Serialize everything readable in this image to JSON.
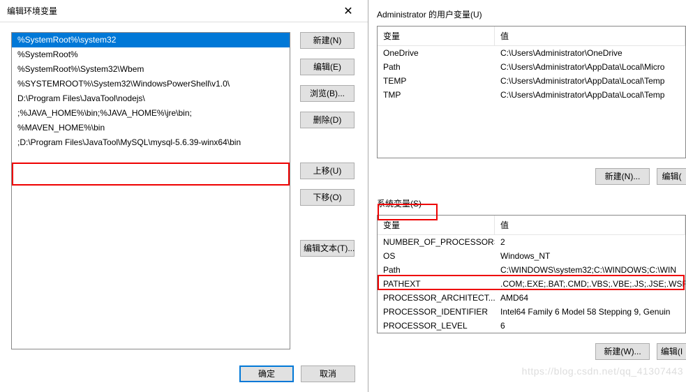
{
  "left_dialog": {
    "title": "编辑环境变量",
    "list": [
      "%SystemRoot%\\system32",
      "%SystemRoot%",
      "%SystemRoot%\\System32\\Wbem",
      "%SYSTEMROOT%\\System32\\WindowsPowerShell\\v1.0\\",
      "D:\\Program Files\\JavaTool\\nodejs\\",
      ";%JAVA_HOME%\\bin;%JAVA_HOME%\\jre\\bin;",
      "%MAVEN_HOME%\\bin",
      ";D:\\Program Files\\JavaTool\\MySQL\\mysql-5.6.39-winx64\\bin"
    ],
    "selected_index": 0,
    "buttons": {
      "new": "新建(N)",
      "edit": "编辑(E)",
      "browse": "浏览(B)...",
      "delete": "删除(D)",
      "move_up": "上移(U)",
      "move_down": "下移(O)",
      "edit_text": "编辑文本(T)..."
    },
    "ok": "确定",
    "cancel": "取消"
  },
  "right": {
    "user_vars_label": "Administrator 的用户变量(U)",
    "sys_vars_label": "系统变量(S)",
    "headers": {
      "name": "变量",
      "value": "值"
    },
    "user_vars": [
      {
        "name": "OneDrive",
        "value": "C:\\Users\\Administrator\\OneDrive"
      },
      {
        "name": "Path",
        "value": "C:\\Users\\Administrator\\AppData\\Local\\Micro"
      },
      {
        "name": "TEMP",
        "value": "C:\\Users\\Administrator\\AppData\\Local\\Temp"
      },
      {
        "name": "TMP",
        "value": "C:\\Users\\Administrator\\AppData\\Local\\Temp"
      }
    ],
    "sys_vars": [
      {
        "name": "NUMBER_OF_PROCESSORS",
        "value": "2"
      },
      {
        "name": "OS",
        "value": "Windows_NT"
      },
      {
        "name": "Path",
        "value": "C:\\WINDOWS\\system32;C:\\WINDOWS;C:\\WIN"
      },
      {
        "name": "PATHEXT",
        "value": ".COM;.EXE;.BAT;.CMD;.VBS;.VBE;.JS;.JSE;.WSF;"
      },
      {
        "name": "PROCESSOR_ARCHITECT...",
        "value": "AMD64"
      },
      {
        "name": "PROCESSOR_IDENTIFIER",
        "value": "Intel64 Family 6 Model 58 Stepping 9, Genuin"
      },
      {
        "name": "PROCESSOR_LEVEL",
        "value": "6"
      }
    ],
    "buttons": {
      "new_n": "新建(N)...",
      "edit_e": "编辑(",
      "new_w": "新建(W)...",
      "edit_i": "编辑(I"
    }
  },
  "watermark": "https://blog.csdn.net/qq_41307443"
}
